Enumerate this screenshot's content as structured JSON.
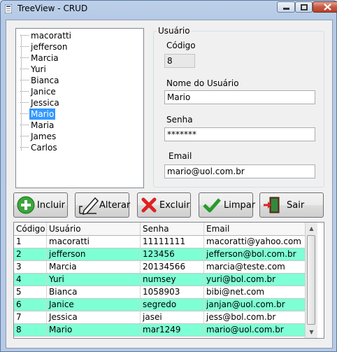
{
  "window": {
    "title": "TreeView - CRUD"
  },
  "tree": {
    "items": [
      "macoratti",
      "jefferson",
      "Marcia",
      "Yuri",
      "Bianca",
      "Janice",
      "Jessica",
      "Mario",
      "Maria",
      "James",
      "Carlos"
    ],
    "selected": "Mario"
  },
  "group": {
    "title": "Usuário",
    "codigo_label": "Código",
    "codigo_value": "8",
    "nome_label": "Nome do Usuário",
    "nome_value": "Mario",
    "senha_label": "Senha",
    "senha_value": "*******",
    "email_label": "Email",
    "email_value": "mario@uol.com.br"
  },
  "buttons": {
    "incluir": "Incluir",
    "alterar": "Alterar",
    "excluir": "Excluir",
    "limpar": "Limpar",
    "sair": "Sair"
  },
  "grid": {
    "headers": [
      "Código",
      "Usuário",
      "Senha",
      "Email"
    ],
    "rows": [
      [
        "1",
        "macoratti",
        "11111111",
        "macoratti@yahoo.com"
      ],
      [
        "2",
        "jefferson",
        "123456",
        "jefferson@bol.com.br"
      ],
      [
        "3",
        "Marcia",
        "20134566",
        "marcia@teste.com"
      ],
      [
        "4",
        "Yuri",
        "numsey",
        "yuri@bol.com.br"
      ],
      [
        "5",
        "Bianca",
        "1058903",
        "bibi@net.com"
      ],
      [
        "6",
        "Janice",
        "segredo",
        "janjan@uol.com.br"
      ],
      [
        "7",
        "Jessica",
        "jasei",
        "jess@bol.com.br"
      ],
      [
        "8",
        "Mario",
        "mar1249",
        "mario@uol.com.br"
      ]
    ],
    "alt_row_color": "#7fffd4"
  },
  "icons": {
    "incluir": "plus-circle-icon",
    "alterar": "edit-pencil-icon",
    "excluir": "red-x-icon",
    "limpar": "green-check-icon",
    "sair": "exit-door-icon"
  }
}
